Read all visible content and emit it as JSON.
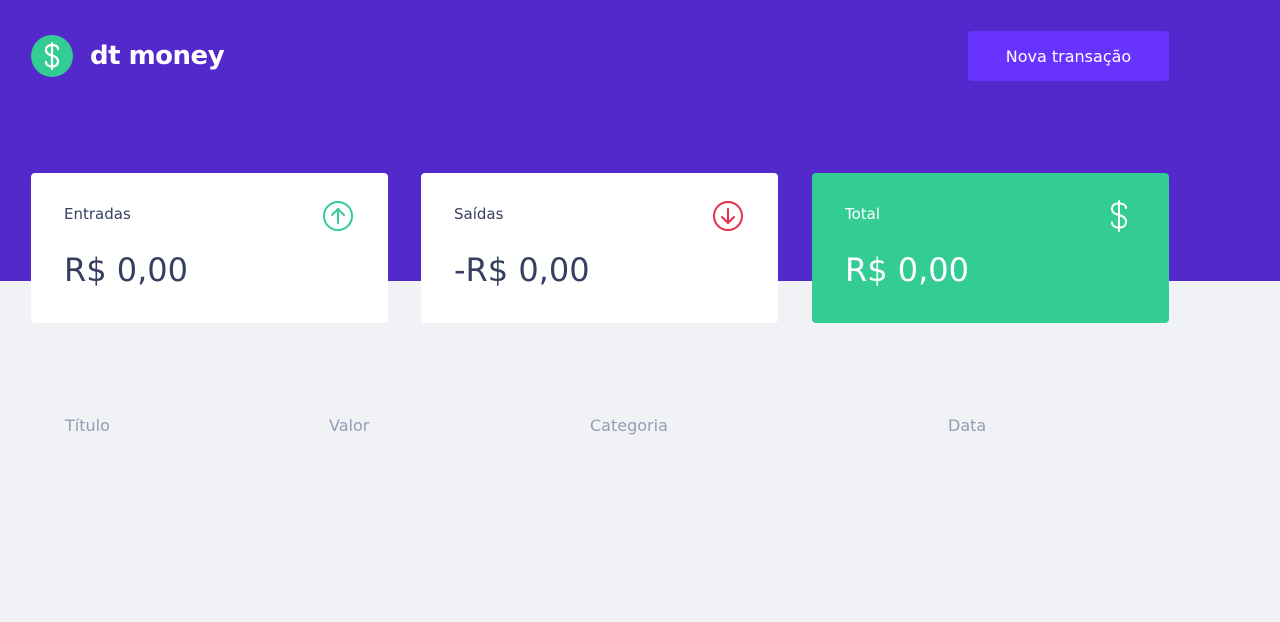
{
  "header": {
    "brand": "dt money",
    "new_transaction_label": "Nova transação"
  },
  "summary": {
    "income": {
      "label": "Entradas",
      "value": "R$ 0,00",
      "icon": "arrow-up-circle-icon",
      "color": "#33CC95"
    },
    "outcome": {
      "label": "Saídas",
      "value": "-R$ 0,00",
      "icon": "arrow-down-circle-icon",
      "color": "#E52E4D"
    },
    "total": {
      "label": "Total",
      "value": "R$ 0,00",
      "icon": "dollar-icon",
      "color": "#33CC95"
    }
  },
  "table": {
    "columns": [
      "Título",
      "Valor",
      "Categoria",
      "Data"
    ],
    "rows": []
  },
  "colors": {
    "header_bg": "#5429CC",
    "button_bg": "#6933FF",
    "page_bg": "#F0F2F5",
    "text": "#363F5F",
    "muted": "#969CB3"
  }
}
